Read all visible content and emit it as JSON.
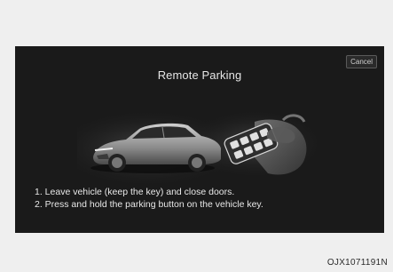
{
  "screen": {
    "title": "Remote Parking",
    "cancel_label": "Cancel",
    "instructions": [
      "1. Leave vehicle (keep the key) and close doors.",
      "2. Press and hold the parking button on the vehicle key."
    ]
  },
  "illustration": {
    "car_icon": "car-icon",
    "key_fob_icon": "key-fob-icon",
    "hand_icon": "hand-icon"
  },
  "figure_code": "OJX1071191N"
}
